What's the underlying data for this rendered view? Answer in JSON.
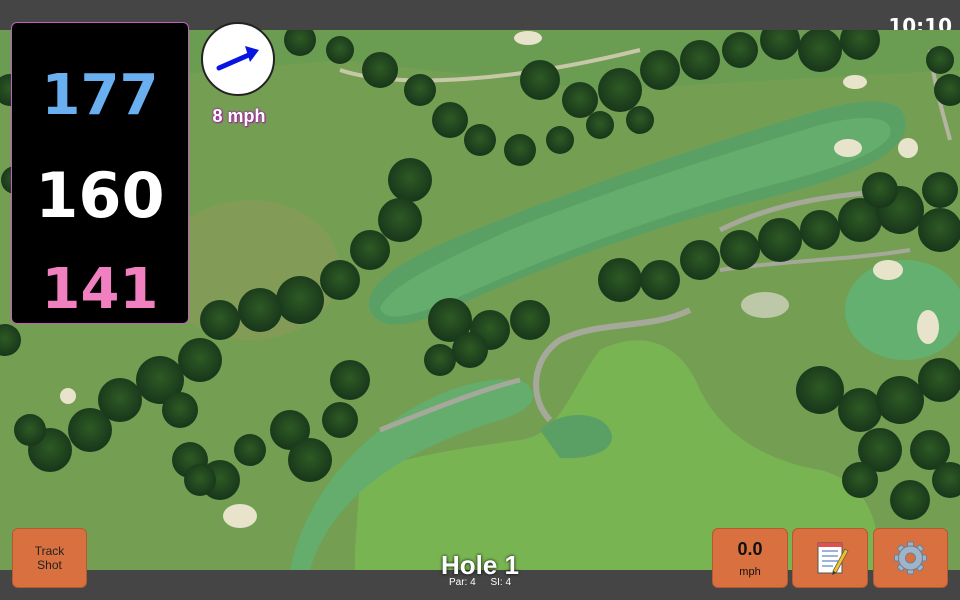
{
  "status": {
    "time": "10:10"
  },
  "yardage": {
    "back": "177",
    "middle": "160",
    "front": "141"
  },
  "wind": {
    "speed_text": "8 mph",
    "icon": "wind-arrow-icon",
    "color": "#0a14e0"
  },
  "buttons": {
    "track_shot": "Track\nShot",
    "speed_value": "0.0",
    "speed_unit": "mph",
    "note_icon": "notepad-icon",
    "settings_icon": "gear-icon"
  },
  "hole": {
    "title": "Hole 1",
    "par": "Par: 4",
    "si": "SI: 4"
  },
  "colors": {
    "button": "#d9703f",
    "back_yardage": "#6ab0f0",
    "front_yardage": "#f080c0",
    "bar": "#454545"
  }
}
